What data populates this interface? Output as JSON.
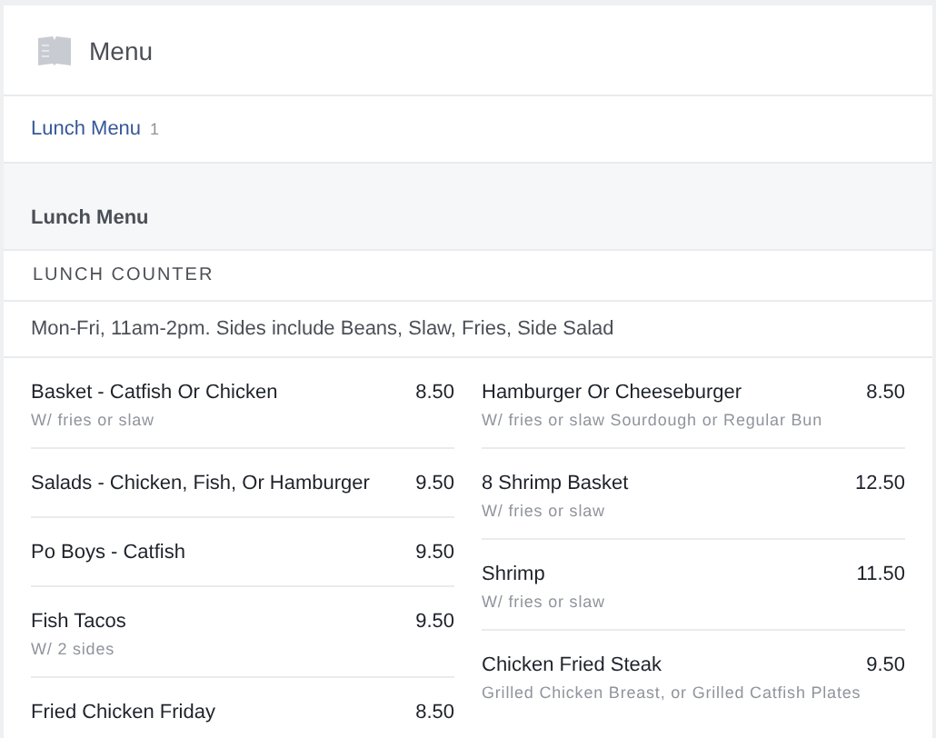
{
  "header": {
    "title": "Menu"
  },
  "menu_link": {
    "label": "Lunch Menu",
    "count": "1"
  },
  "section": {
    "title": "Lunch Menu",
    "subtitle": "LUNCH COUNTER",
    "description": "Mon-Fri, 11am-2pm. Sides include Beans, Slaw, Fries, Side Salad"
  },
  "columns": [
    [
      {
        "name": "Basket - Catfish Or Chicken",
        "price": "8.50",
        "note": "W/ fries or slaw"
      },
      {
        "name": "Salads - Chicken, Fish, Or Hamburger",
        "price": "9.50"
      },
      {
        "name": "Po Boys - Catfish",
        "price": "9.50"
      },
      {
        "name": "Fish Tacos",
        "price": "9.50",
        "note": "W/ 2 sides"
      },
      {
        "name": "Fried Chicken Friday",
        "price": "8.50"
      }
    ],
    [
      {
        "name": "Hamburger Or Cheeseburger",
        "price": "8.50",
        "note": "W/ fries or slaw Sourdough or Regular Bun"
      },
      {
        "name": "8 Shrimp Basket",
        "price": "12.50",
        "note": "W/ fries or slaw"
      },
      {
        "name": "Shrimp",
        "price": "11.50",
        "note": "W/ fries or slaw"
      },
      {
        "name": "Chicken Fried Steak",
        "price": "9.50",
        "note": "Grilled Chicken Breast, or Grilled Catfish Plates"
      }
    ]
  ]
}
